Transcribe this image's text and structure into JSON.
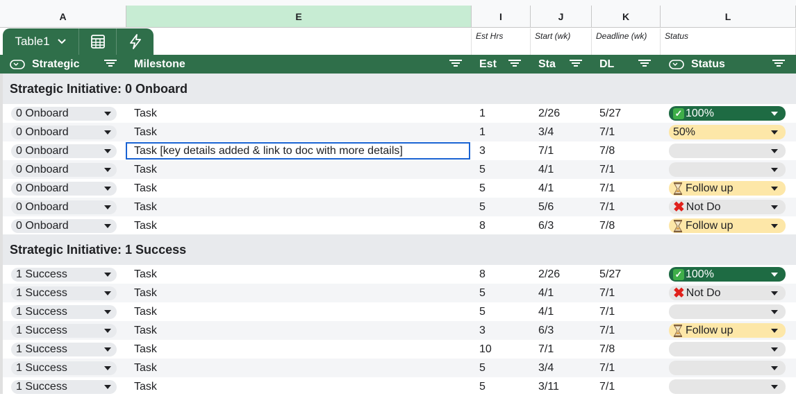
{
  "columns": {
    "A": "A",
    "E": "E",
    "I": "I",
    "J": "J",
    "K": "K",
    "L": "L"
  },
  "subheader": {
    "est": "Est Hrs",
    "start": "Start (wk)",
    "deadline": "Deadline (wk)",
    "status": "Status"
  },
  "toolbar": {
    "table_name": "Table1"
  },
  "headers": {
    "strategic": "Strategic",
    "milestone": "Milestone",
    "est": "Est",
    "sta": "Sta",
    "dl": "DL",
    "status": "Status"
  },
  "groups": [
    {
      "title": "Strategic Initiative: 0 Onboard",
      "rows": [
        {
          "strategic": "0 Onboard",
          "milestone": "Task",
          "est": "1",
          "sta": "2/26",
          "dl": "5/27",
          "status": "100%",
          "kind": "done"
        },
        {
          "strategic": "0 Onboard",
          "milestone": "Task",
          "est": "1",
          "sta": "3/4",
          "dl": "7/1",
          "status": "50%",
          "kind": "pct"
        },
        {
          "strategic": "0 Onboard",
          "milestone": "Task [key details added & link to doc with more details]",
          "est": "3",
          "sta": "7/1",
          "dl": "7/8",
          "status": "",
          "kind": "empty",
          "editing": true
        },
        {
          "strategic": "0 Onboard",
          "milestone": "Task",
          "est": "5",
          "sta": "4/1",
          "dl": "7/1",
          "status": "",
          "kind": "empty"
        },
        {
          "strategic": "0 Onboard",
          "milestone": "Task",
          "est": "5",
          "sta": "4/1",
          "dl": "7/1",
          "status": "Follow up",
          "kind": "follow"
        },
        {
          "strategic": "0 Onboard",
          "milestone": "Task",
          "est": "5",
          "sta": "5/6",
          "dl": "7/1",
          "status": "Not Do",
          "kind": "notdo"
        },
        {
          "strategic": "0 Onboard",
          "milestone": "Task",
          "est": "8",
          "sta": "6/3",
          "dl": "7/8",
          "status": "Follow up",
          "kind": "follow"
        }
      ]
    },
    {
      "title": "Strategic Initiative: 1 Success",
      "rows": [
        {
          "strategic": "1 Success",
          "milestone": "Task",
          "est": "8",
          "sta": "2/26",
          "dl": "5/27",
          "status": "100%",
          "kind": "done"
        },
        {
          "strategic": "1 Success",
          "milestone": "Task",
          "est": "5",
          "sta": "4/1",
          "dl": "7/1",
          "status": "Not Do",
          "kind": "notdo"
        },
        {
          "strategic": "1 Success",
          "milestone": "Task",
          "est": "5",
          "sta": "4/1",
          "dl": "7/1",
          "status": "",
          "kind": "empty"
        },
        {
          "strategic": "1 Success",
          "milestone": "Task",
          "est": "3",
          "sta": "6/3",
          "dl": "7/1",
          "status": "Follow up",
          "kind": "follow"
        },
        {
          "strategic": "1 Success",
          "milestone": "Task",
          "est": "10",
          "sta": "7/1",
          "dl": "7/8",
          "status": "",
          "kind": "empty"
        },
        {
          "strategic": "1 Success",
          "milestone": "Task",
          "est": "5",
          "sta": "3/4",
          "dl": "7/1",
          "status": "",
          "kind": "empty"
        },
        {
          "strategic": "1 Success",
          "milestone": "Task",
          "est": "5",
          "sta": "3/11",
          "dl": "7/1",
          "status": "",
          "kind": "empty"
        }
      ]
    }
  ],
  "colors": {
    "header_green": "#2f6f4a",
    "done_green": "#1e6b43",
    "followup_yellow": "#fde7a8",
    "selection_blue": "#1a63d3"
  }
}
